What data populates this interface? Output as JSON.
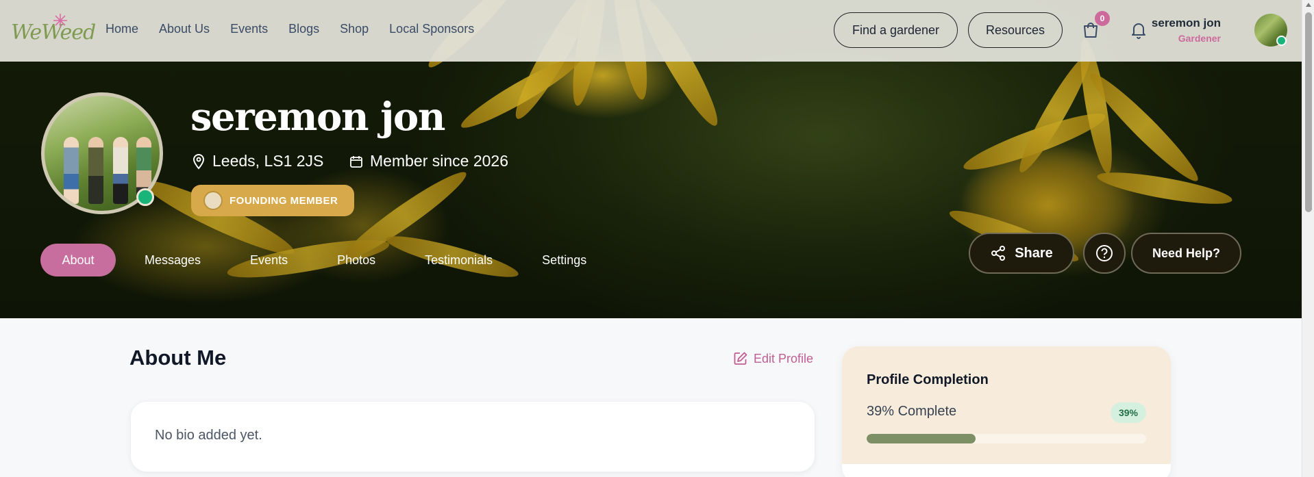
{
  "header": {
    "logo_text": "WeWeed",
    "nav": [
      "Home",
      "About Us",
      "Events",
      "Blogs",
      "Shop",
      "Local Sponsors"
    ],
    "find_gardener_label": "Find a gardener",
    "resources_label": "Resources",
    "cart_count": "0",
    "user_name": "seremon jon",
    "user_role": "Gardener"
  },
  "profile": {
    "name": "seremon jon",
    "location": "Leeds, LS1 2JS",
    "member_since": "Member since 2026",
    "badge_label": "FOUNDING MEMBER",
    "tabs": [
      "About",
      "Messages",
      "Events",
      "Photos",
      "Testimonials",
      "Settings"
    ],
    "active_tab": "About",
    "share_label": "Share",
    "help_label": "Need Help?"
  },
  "main": {
    "about_title": "About Me",
    "edit_label": "Edit Profile",
    "bio_text": "No bio added yet."
  },
  "completion": {
    "title": "Profile Completion",
    "percent_text": "39% Complete",
    "percent_badge": "39%",
    "progress": 0.39
  },
  "colors": {
    "accent_pink": "#c86e9f",
    "gold": "#d8a94a",
    "online_green": "#19b47a",
    "progress_fill": "#7d8f64"
  }
}
